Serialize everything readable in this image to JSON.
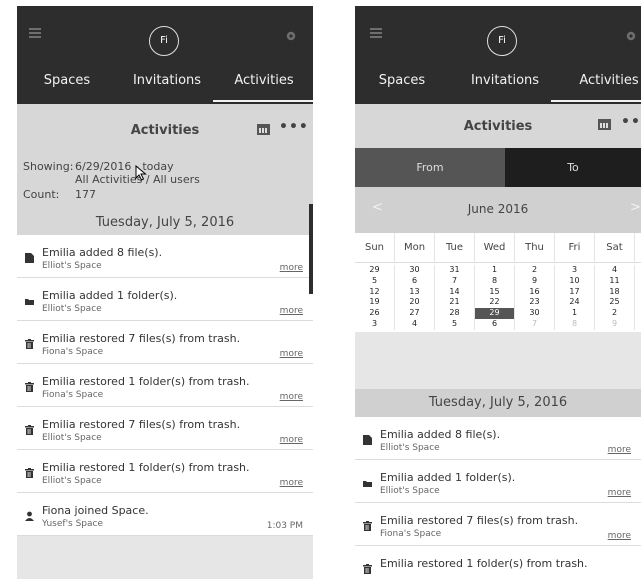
{
  "left": {
    "tabs": [
      "Spaces",
      "Invitations",
      "Activities"
    ],
    "avatar": "Fi",
    "title": "Activities",
    "showing_label": "Showing:",
    "showing_value": "6/29/2016 - today",
    "showing_sub": "All Activities / All users",
    "count_label": "Count:",
    "count_value": "177",
    "day_header": "Tuesday, July 5, 2016",
    "items": [
      {
        "icon": "file-icon",
        "text": "Emilia added 8 file(s).",
        "space": "Elliot's Space",
        "right": "more"
      },
      {
        "icon": "folder-icon",
        "text": "Emilia added 1 folder(s).",
        "space": "Elliot's Space",
        "right": "more"
      },
      {
        "icon": "trash-icon",
        "text": "Emilia restored 7 files(s) from trash.",
        "space": "Fiona's Space",
        "right": "more"
      },
      {
        "icon": "trash-icon",
        "text": "Emilia restored 1 folder(s) from trash.",
        "space": "Fiona's Space",
        "right": "more"
      },
      {
        "icon": "trash-icon",
        "text": "Emilia restored 7 files(s) from trash.",
        "space": "Elliot's Space",
        "right": "more"
      },
      {
        "icon": "trash-icon",
        "text": "Emilia restored 1 folder(s) from trash.",
        "space": "Elliot's Space",
        "right": "more"
      },
      {
        "icon": "user-icon",
        "text": "Fiona joined Space.",
        "space": "Yusef's Space",
        "right": "1:03 PM"
      }
    ]
  },
  "right": {
    "tabs": [
      "Spaces",
      "Invitations",
      "Activities"
    ],
    "avatar": "Fi",
    "title": "Activities",
    "from_label": "From",
    "to_label": "To",
    "month": "June 2016",
    "prev": "<",
    "next": ">",
    "dow": [
      "Sun",
      "Mon",
      "Tue",
      "Wed",
      "Thu",
      "Fri",
      "Sat"
    ],
    "weeks": [
      [
        "29",
        "30",
        "31",
        "1",
        "2",
        "3",
        "4"
      ],
      [
        "5",
        "6",
        "7",
        "8",
        "9",
        "10",
        "11"
      ],
      [
        "12",
        "13",
        "14",
        "15",
        "16",
        "17",
        "18"
      ],
      [
        "19",
        "20",
        "21",
        "22",
        "23",
        "24",
        "25"
      ],
      [
        "26",
        "27",
        "28",
        "29",
        "30",
        "1",
        "2"
      ],
      [
        "3",
        "4",
        "5",
        "6",
        "7",
        "8",
        "9"
      ]
    ],
    "selected_day": "29",
    "day_header": "Tuesday, July 5, 2016",
    "items": [
      {
        "icon": "file-icon",
        "text": "Emilia added 8 file(s).",
        "space": "Elliot's Space",
        "right": "more"
      },
      {
        "icon": "folder-icon",
        "text": "Emilia added 1 folder(s).",
        "space": "Elliot's Space",
        "right": "more"
      },
      {
        "icon": "trash-icon",
        "text": "Emilia restored 7 files(s) from trash.",
        "space": "Fiona's Space",
        "right": "more"
      },
      {
        "icon": "trash-icon",
        "text": "Emilia restored 1 folder(s) from trash.",
        "space": "",
        "right": ""
      }
    ]
  },
  "colors": {
    "topbar": "#2d2d2d",
    "subheader": "#d7d7d7",
    "selected": "#555555"
  }
}
